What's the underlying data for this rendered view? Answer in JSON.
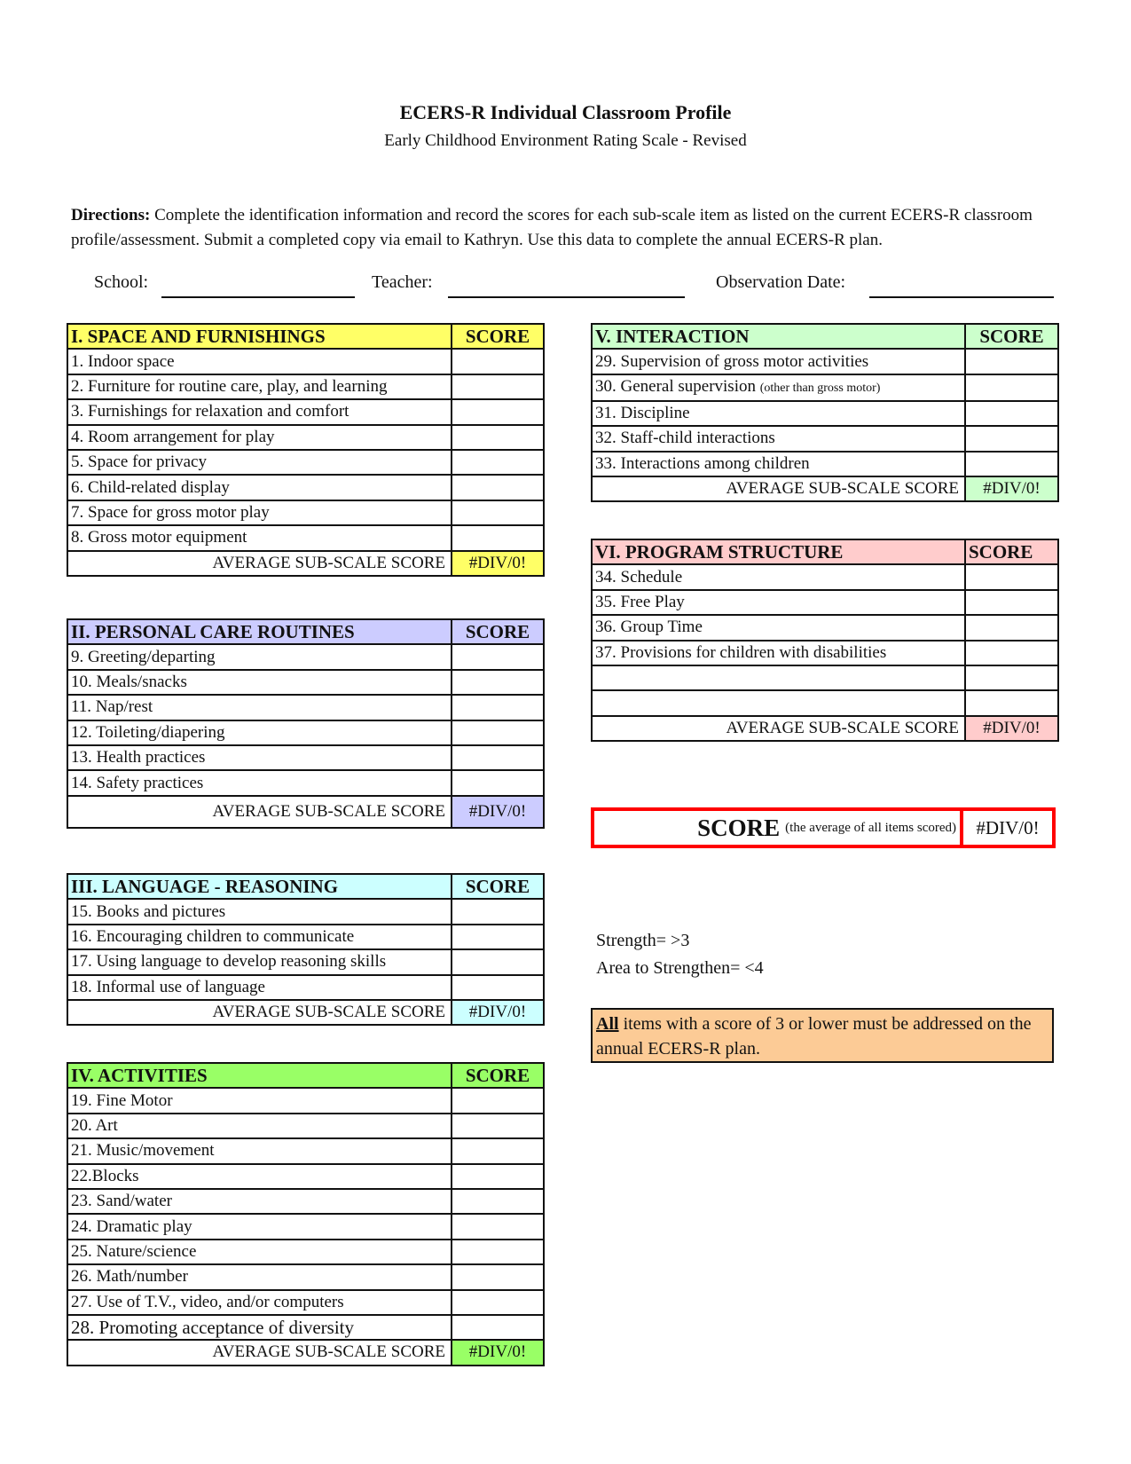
{
  "header": {
    "title": "ECERS-R Individual Classroom Profile",
    "subtitle": "Early Childhood Environment Rating Scale - Revised"
  },
  "directions": {
    "label": "Directions:",
    "text": " Complete the identification information and record the scores for each sub-scale item as listed on the current ECERS-R classroom profile/assessment. Submit a completed copy via email to Kathryn. Use this data to complete the annual ECERS-R plan."
  },
  "identification": {
    "school_label": "School:",
    "school_value": "",
    "teacher_label": "Teacher:",
    "teacher_value": "",
    "date_label": "Observation Date:",
    "date_value": ""
  },
  "score_header": "SCORE",
  "average_label": "AVERAGE SUB-SCALE SCORE",
  "sections": [
    {
      "title": "I. SPACE AND FURNISHINGS",
      "color": "#ffff66",
      "items": [
        "1. Indoor space",
        "2. Furniture for routine care, play, and learning",
        "3. Furnishings for relaxation and comfort",
        "4. Room arrangement for play",
        "5. Space for privacy",
        "6. Child-related display",
        "7. Space for gross motor play",
        "8. Gross motor equipment"
      ],
      "average": "#DIV/0!"
    },
    {
      "title": "II. PERSONAL CARE ROUTINES",
      "color": "#ccccff",
      "items": [
        "9. Greeting/departing",
        "10. Meals/snacks",
        "11. Nap/rest",
        "12. Toileting/diapering",
        "13. Health practices",
        "14. Safety practices"
      ],
      "average": "#DIV/0!"
    },
    {
      "title": "III. LANGUAGE - REASONING",
      "color": "#ccffff",
      "items": [
        "15. Books and pictures",
        "16. Encouraging children to communicate",
        "17. Using language to develop reasoning skills",
        "18. Informal use of language"
      ],
      "average": "#DIV/0!"
    },
    {
      "title": "IV. ACTIVITIES",
      "color": "#99ff66",
      "items": [
        "19. Fine Motor",
        "20. Art",
        "21. Music/movement",
        "22.Blocks",
        "23. Sand/water",
        "24. Dramatic play",
        "25. Nature/science",
        "26. Math/number",
        "27. Use of T.V., video, and/or computers",
        "28. Promoting acceptance of diversity"
      ],
      "average": "#DIV/0!"
    },
    {
      "title": "V. INTERACTION",
      "color": "#ccffcc",
      "items": [
        "29. Supervision of gross motor activities",
        "30. General supervision",
        "31. Discipline",
        "32. Staff-child interactions",
        "33. Interactions among children"
      ],
      "item_notes": {
        "1": "(other than gross motor)"
      },
      "average": "#DIV/0!"
    },
    {
      "title": "VI. PROGRAM STRUCTURE",
      "color": "#ffcccc",
      "items": [
        "34. Schedule",
        "35.  Free Play",
        "36. Group Time",
        "37. Provisions for children with disabilities",
        "",
        ""
      ],
      "average": "#DIV/0!"
    }
  ],
  "final_score": {
    "label": "SCORE",
    "note": "(the average of all items scored)",
    "value": "#DIV/0!",
    "border_color": "#ff0000"
  },
  "legend": {
    "strength": "Strength=  >3",
    "area_to_strengthen": "Area to Strengthen=   <4"
  },
  "notice": {
    "emphasis": "All",
    "text": " items with a score of 3 or lower must be addressed on the annual ECERS-R plan.",
    "color": "#fccb96"
  }
}
